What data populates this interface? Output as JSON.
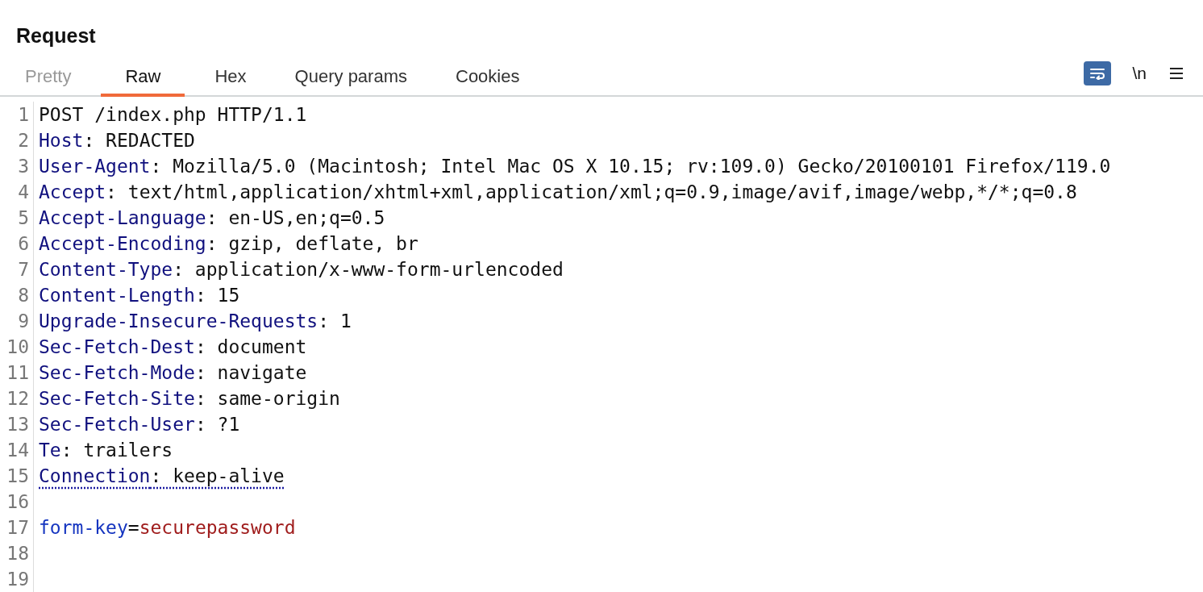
{
  "panel": {
    "title": "Request"
  },
  "tabs": [
    {
      "label": "Pretty",
      "selected": false,
      "disabled": true
    },
    {
      "label": "Raw",
      "selected": true,
      "disabled": false
    },
    {
      "label": "Hex",
      "selected": false,
      "disabled": false
    },
    {
      "label": "Query params",
      "selected": false,
      "disabled": false
    },
    {
      "label": "Cookies",
      "selected": false,
      "disabled": false
    }
  ],
  "toolbar": {
    "wrap_lines": {
      "on": true
    },
    "newline_label": "\\n"
  },
  "lines": [
    {
      "number": "1",
      "kind": "request_line",
      "text": "POST /index.php HTTP/1.1"
    },
    {
      "number": "2",
      "kind": "header",
      "name": "Host",
      "separator": ": ",
      "value": "REDACTED",
      "underlined": false
    },
    {
      "number": "3",
      "kind": "header",
      "name": "User-Agent",
      "separator": ": ",
      "value": "Mozilla/5.0 (Macintosh; Intel Mac OS X 10.15; rv:109.0) Gecko/20100101 Firefox/119.0",
      "underlined": false
    },
    {
      "number": "4",
      "kind": "header",
      "name": "Accept",
      "separator": ": ",
      "value": "text/html,application/xhtml+xml,application/xml;q=0.9,image/avif,image/webp,*/*;q=0.8",
      "underlined": false
    },
    {
      "number": "5",
      "kind": "header",
      "name": "Accept-Language",
      "separator": ": ",
      "value": "en-US,en;q=0.5",
      "underlined": false
    },
    {
      "number": "6",
      "kind": "header",
      "name": "Accept-Encoding",
      "separator": ": ",
      "value": "gzip, deflate, br",
      "underlined": false
    },
    {
      "number": "7",
      "kind": "header",
      "name": "Content-Type",
      "separator": ": ",
      "value": "application/x-www-form-urlencoded",
      "underlined": false
    },
    {
      "number": "8",
      "kind": "header",
      "name": "Content-Length",
      "separator": ": ",
      "value": "15",
      "underlined": false
    },
    {
      "number": "9",
      "kind": "header",
      "name": "Upgrade-Insecure-Requests",
      "separator": ": ",
      "value": "1",
      "underlined": false
    },
    {
      "number": "10",
      "kind": "header",
      "name": "Sec-Fetch-Dest",
      "separator": ": ",
      "value": "document",
      "underlined": false
    },
    {
      "number": "11",
      "kind": "header",
      "name": "Sec-Fetch-Mode",
      "separator": ": ",
      "value": "navigate",
      "underlined": false
    },
    {
      "number": "12",
      "kind": "header",
      "name": "Sec-Fetch-Site",
      "separator": ": ",
      "value": "same-origin",
      "underlined": false
    },
    {
      "number": "13",
      "kind": "header",
      "name": "Sec-Fetch-User",
      "separator": ": ",
      "value": "?1",
      "underlined": false
    },
    {
      "number": "14",
      "kind": "header",
      "name": "Te",
      "separator": ": ",
      "value": "trailers",
      "underlined": false
    },
    {
      "number": "15",
      "kind": "header",
      "name": "Connection",
      "separator": ": ",
      "value": "keep-alive",
      "underlined": true
    },
    {
      "number": "16",
      "kind": "blank"
    },
    {
      "number": "17",
      "kind": "param",
      "name": "form-key",
      "separator": "=",
      "value": "securepassword"
    },
    {
      "number": "18",
      "kind": "blank"
    },
    {
      "number": "19",
      "kind": "blank"
    }
  ]
}
